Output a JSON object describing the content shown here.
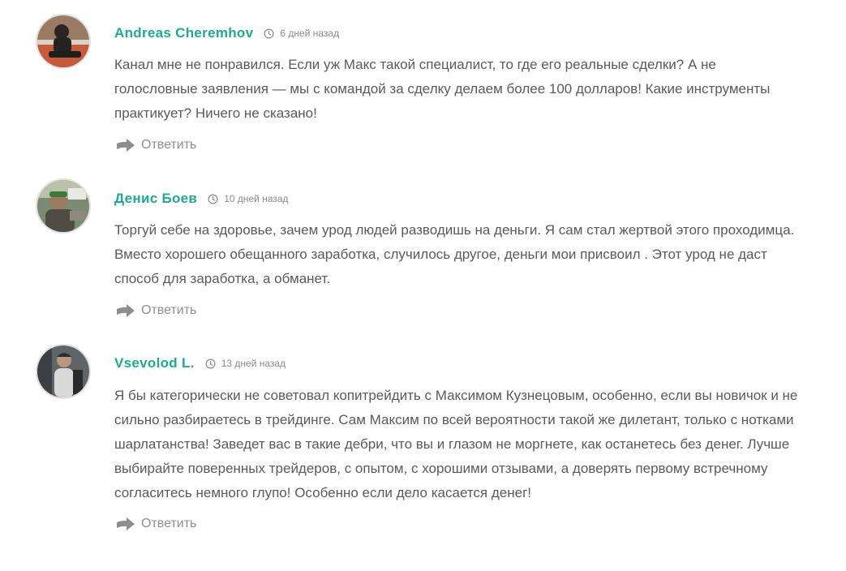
{
  "comments": [
    {
      "author": "Andreas Cheremhov",
      "time": "6 дней назад",
      "text": "Канал мне не понравился. Если уж Макс такой специалист, то где его реальные сделки? А не голословные заявления — мы с командой за сделку делаем более 100 долларов! Какие инструменты практикует? Ничего не сказано!",
      "reply_label": "Ответить"
    },
    {
      "author": "Денис Боев",
      "time": "10 дней назад",
      "text": "Торгуй себе на здоровье, зачем урод людей разводишь на деньги. Я сам стал жертвой этого проходимца. Вместо хорошего обещанного заработка, случилось другое, деньги мои присвоил . Этот урод не даст способ для заработка, а обманет.",
      "reply_label": "Ответить"
    },
    {
      "author": "Vsevolod L.",
      "time": "13 дней назад",
      "text": "Я бы категорически не советовал копитрейдить с Максимом Кузнецовым, особенно, если вы новичок и не сильно разбираетесь в трейдинге. Сам Максим по всей вероятности такой же дилетант, только с нотками шарлатанства! Заведет вас в такие дебри, что вы и глазом не моргнете, как останетесь без денег. Лучше выбирайте поверенных трейдеров, с опытом, с хорошими отзывами, а доверять первому встречному согласитесь немного глупо! Особенно если дело касается денег!",
      "reply_label": "Ответить"
    }
  ],
  "icons": {
    "time": "clock-icon",
    "reply": "reply-arrow-icon"
  },
  "colors": {
    "author": "#20a98c",
    "text": "#5a5a5a",
    "muted": "#8e8e8e"
  }
}
